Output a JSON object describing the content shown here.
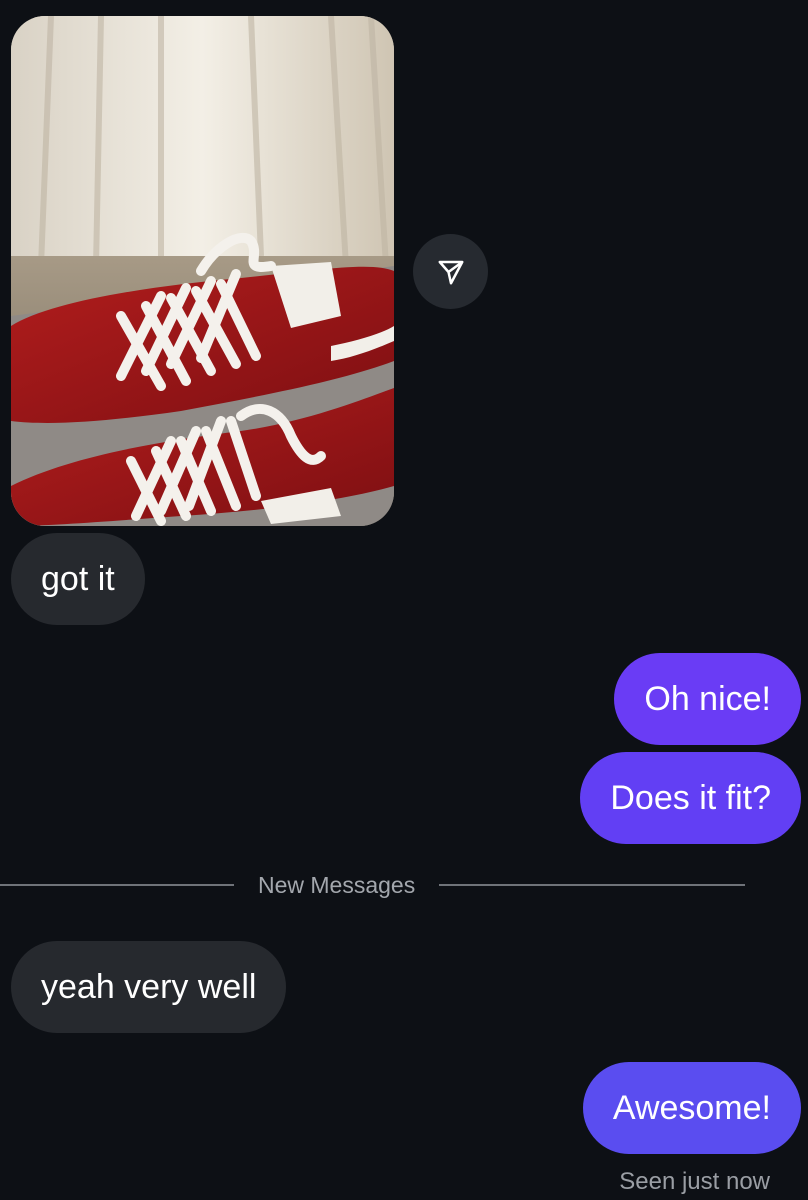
{
  "messages": [
    {
      "id": "photo",
      "type": "image",
      "direction": "incoming",
      "image_alt": "red sneakers with white laces"
    },
    {
      "id": "got_it",
      "direction": "incoming",
      "text": "got it"
    },
    {
      "id": "oh_nice",
      "direction": "outgoing",
      "text": "Oh nice!"
    },
    {
      "id": "fit",
      "direction": "outgoing",
      "text": "Does it fit?"
    },
    {
      "id": "yeah",
      "direction": "incoming",
      "text": "yeah very well"
    },
    {
      "id": "awesome",
      "direction": "outgoing",
      "text": "Awesome!"
    }
  ],
  "divider": {
    "label": "New Messages"
  },
  "status": {
    "seen": "Seen just now"
  },
  "icons": {
    "share": "paper-plane-icon"
  },
  "colors": {
    "background": "#0d1015",
    "incoming_bubble": "#26292e",
    "outgoing_bubble": "#6a3cf5"
  }
}
